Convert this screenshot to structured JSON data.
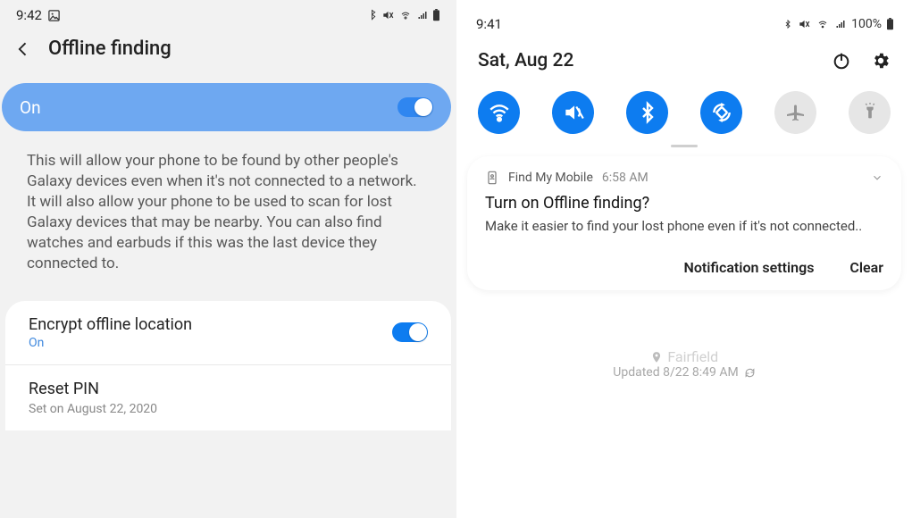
{
  "left": {
    "status": {
      "time": "9:42"
    },
    "header": {
      "title": "Offline finding"
    },
    "toggle": {
      "label": "On"
    },
    "description": "This will allow your phone to be found by other people's Galaxy devices even when it's not connected to a network. It will also allow your phone to be used to scan for lost Galaxy devices that may be nearby. You can also find watches and earbuds if this was the last device they connected to.",
    "rows": [
      {
        "title": "Encrypt offline location",
        "sub": "On"
      },
      {
        "title": "Reset PIN",
        "sub": "Set on August 22, 2020"
      }
    ]
  },
  "right": {
    "status": {
      "time": "9:41",
      "battery": "100%"
    },
    "date": "Sat, Aug 22",
    "notification": {
      "app": "Find My Mobile",
      "time": "6:58 AM",
      "title": "Turn on Offline finding?",
      "body": "Make it easier to find your lost phone even if it's not connected..",
      "action_settings": "Notification settings",
      "action_clear": "Clear"
    },
    "background": {
      "city": "Fairfield",
      "updated": "Updated 8/22 8:49 AM"
    }
  }
}
